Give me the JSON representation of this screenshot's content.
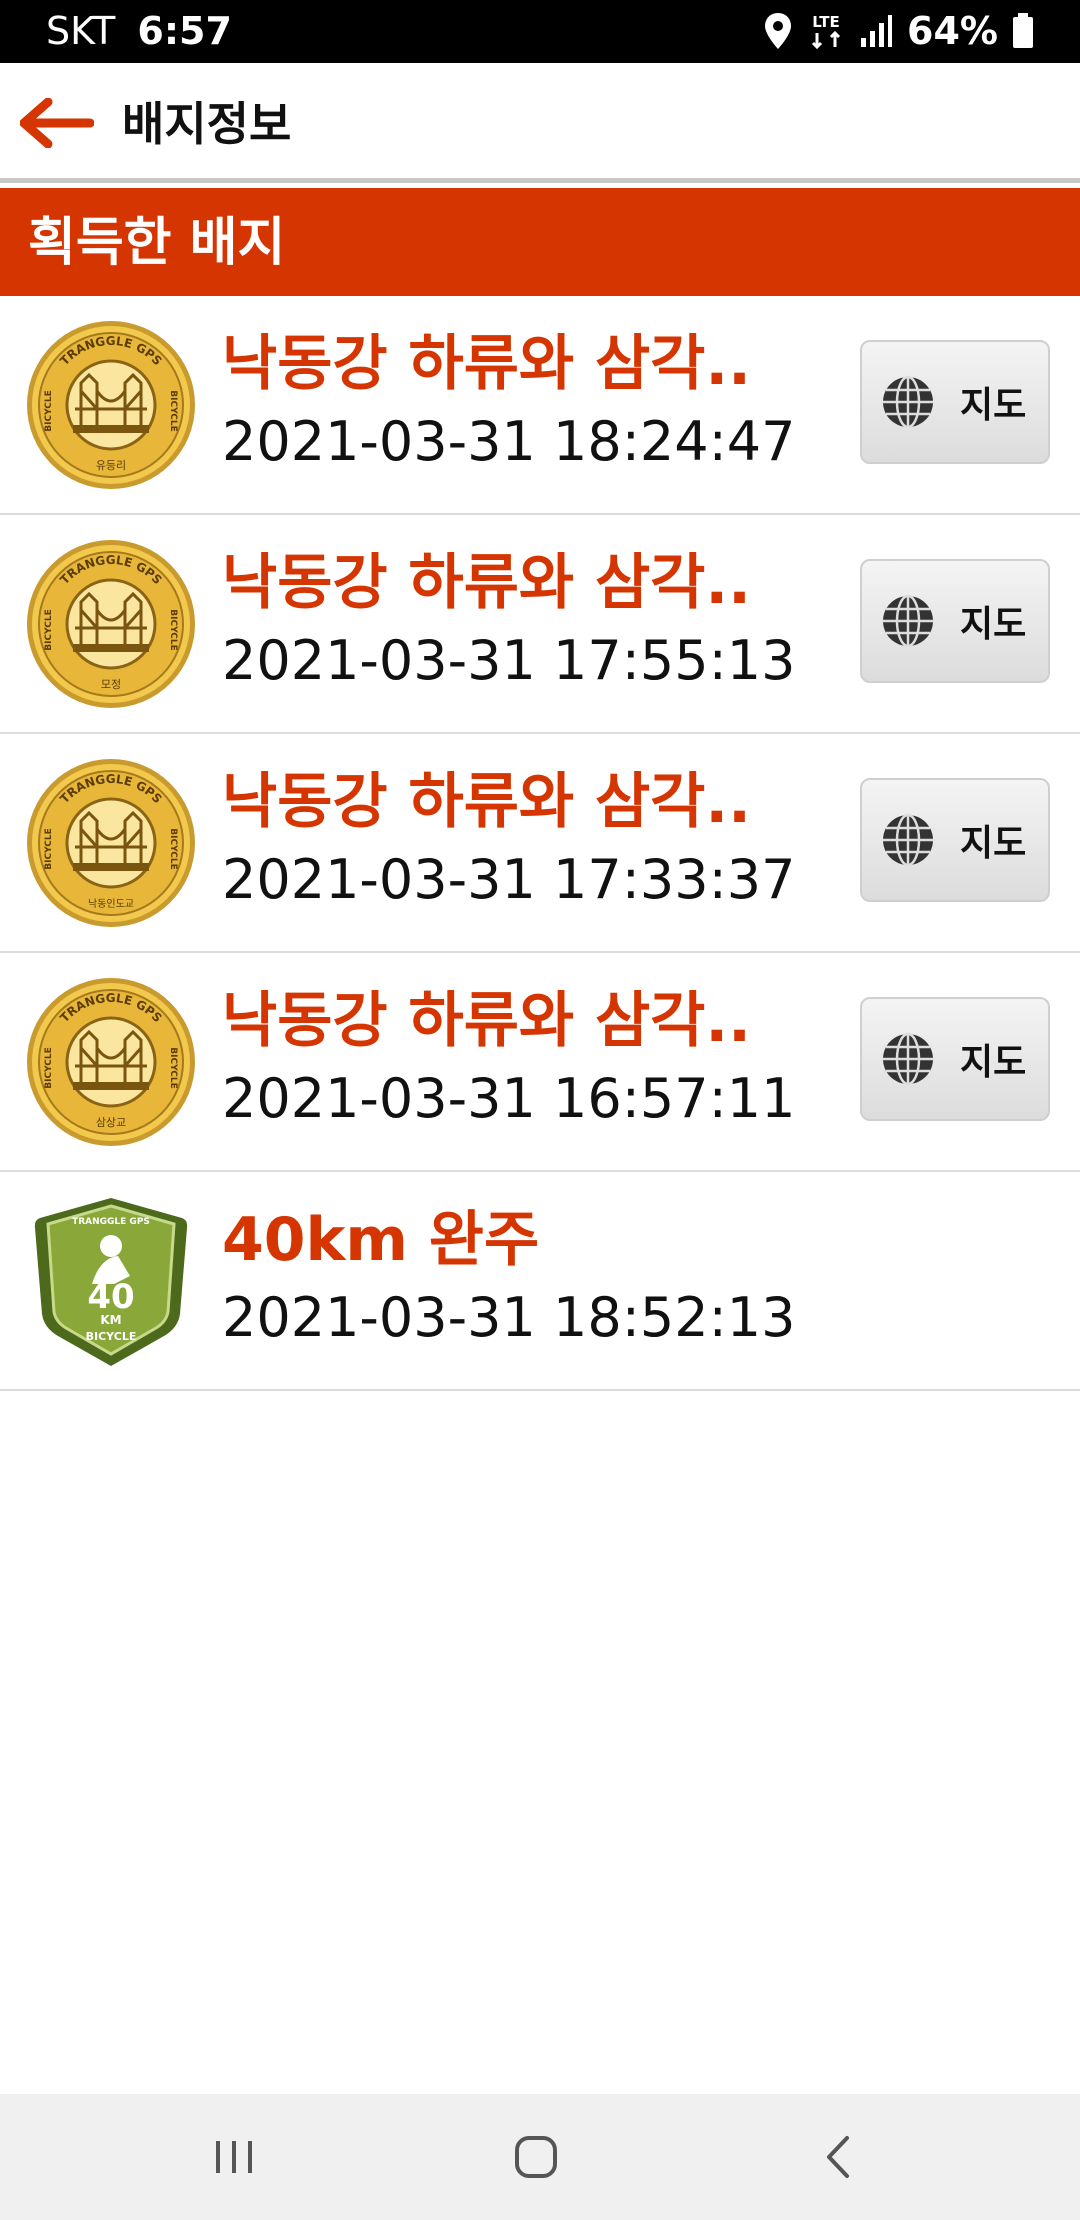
{
  "status_bar": {
    "carrier": "SKT",
    "time": "6:57",
    "network": "LTE",
    "battery": "64%",
    "icons": [
      "location-icon",
      "lte-icon",
      "signal-icon",
      "battery-icon"
    ]
  },
  "app_bar": {
    "title": "배지정보",
    "back_icon": "back-arrow-icon"
  },
  "section": {
    "title": "획득한 배지"
  },
  "badges": [
    {
      "title": "낙동강 하류와 삼각..",
      "date": "2021-03-31 18:24:47",
      "map_label": "지도",
      "emblem_top": "TRANGGLE GPS",
      "emblem_side": "BICYCLE",
      "emblem_place": "유등리"
    },
    {
      "title": "낙동강 하류와 삼각..",
      "date": "2021-03-31 17:55:13",
      "map_label": "지도",
      "emblem_top": "TRANGGLE GPS",
      "emblem_side": "BICYCLE",
      "emblem_place": "모정"
    },
    {
      "title": "낙동강 하류와 삼각..",
      "date": "2021-03-31 17:33:37",
      "map_label": "지도",
      "emblem_top": "TRANGGLE GPS",
      "emblem_side": "BICYCLE",
      "emblem_place": "낙동인도교"
    },
    {
      "title": "낙동강 하류와 삼각..",
      "date": "2021-03-31 16:57:11",
      "map_label": "지도",
      "emblem_top": "TRANGGLE GPS",
      "emblem_side": "BICYCLE",
      "emblem_place": "삼상교"
    },
    {
      "title": "40km 완주",
      "date": "2021-03-31 18:52:13",
      "emblem_top": "TRANGGLE GPS",
      "emblem_num": "40",
      "emblem_unit": "KM",
      "emblem_bottom": "BICYCLE"
    }
  ],
  "nav_bar": {
    "icons": [
      "recent-apps-icon",
      "home-icon",
      "back-icon"
    ]
  },
  "colors": {
    "accent": "#d53500",
    "gold": "#e0a82c",
    "green": "#6b8a2a",
    "nav_bg": "#f0f0f0"
  }
}
